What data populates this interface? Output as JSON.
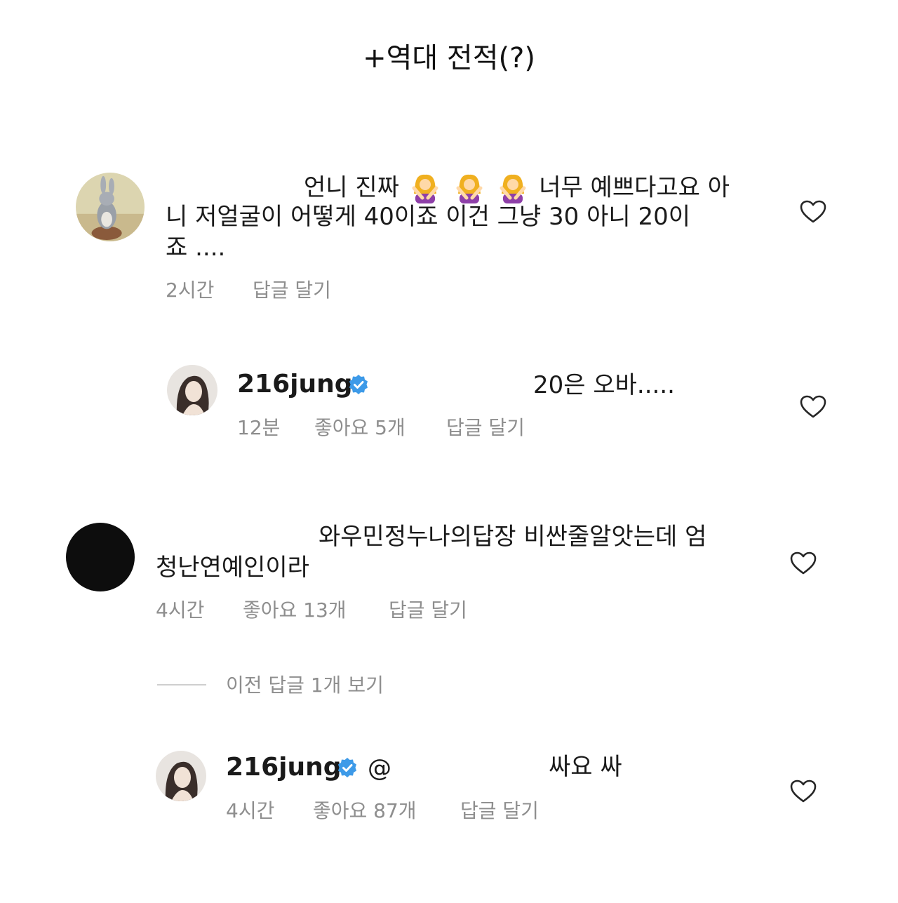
{
  "page_title": "+역대 전적(?)",
  "comments": [
    {
      "line1_a": "언니 진짜",
      "line1_b": "너무 예쁘다고요 아",
      "line2": "니 저얼굴이 어떻게 40이죠 이건 그냥 30 아니 20이",
      "line3": "죠 ....",
      "time": "2시간",
      "reply": "답글 달기",
      "emoji": "woman-gesturing-no-emoji"
    },
    {
      "username": "216jung",
      "text": "20은 오바.....",
      "time": "12분",
      "likes": "좋아요 5개",
      "reply": "답글 달기"
    },
    {
      "line1": "와우민정누나의답장 비싼줄알앗는데 엄",
      "line2": "청난연예인이라",
      "time": "4시간",
      "likes": "좋아요 13개",
      "reply": "답글 달기"
    },
    {
      "view_previous": "이전 답글 1개 보기"
    },
    {
      "username": "216jung",
      "mention": "@",
      "text": "싸요 싸",
      "time": "4시간",
      "likes": "좋아요 87개",
      "reply": "답글 달기"
    }
  ],
  "colors": {
    "text": "#1a1a1a",
    "meta": "#8e8e8e",
    "verified": "#3d9ae8"
  },
  "icons": [
    "heart-icon",
    "verified-badge-icon",
    "avatar"
  ]
}
